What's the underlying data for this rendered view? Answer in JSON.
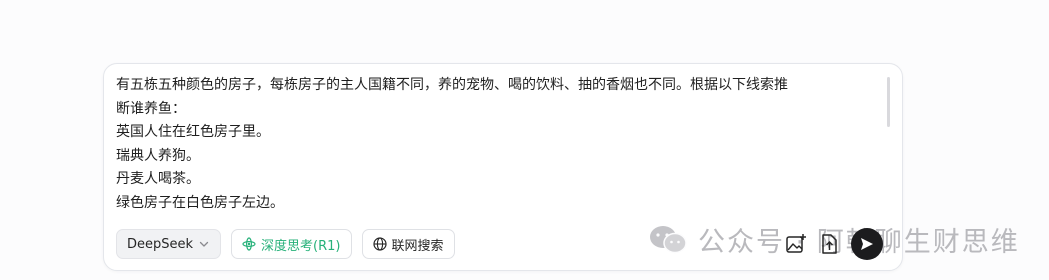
{
  "input": {
    "lines": [
      "有五栋五种颜色的房子，每栋房子的主人国籍不同，养的宠物、喝的饮料、抽的香烟也不同。根据以下线索推",
      "断谁养鱼：",
      "英国人住在红色房子里。",
      "瑞典人养狗。",
      "丹麦人喝茶。",
      "绿色房子在白色房子左边。"
    ]
  },
  "toolbar": {
    "model_label": "DeepSeek",
    "deep_think_label": "深度思考(R1)",
    "web_search_label": "联网搜索"
  },
  "watermark": {
    "text": "公众号 · 阿翰聊生财思维"
  },
  "colors": {
    "accent_green": "#27b17a",
    "send_button": "#1c1c1e",
    "border": "#e4e6eb"
  },
  "icons": {
    "model_chevron": "chevron-down-icon",
    "deep_think": "atom-icon",
    "web_search": "globe-icon",
    "image_upload": "image-add-icon",
    "file_upload": "file-upload-icon",
    "send": "send-arrow-icon",
    "watermark_logo": "wechat-icon"
  }
}
